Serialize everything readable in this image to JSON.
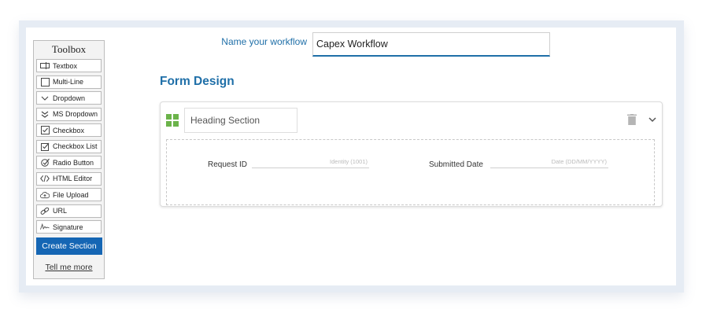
{
  "workflow": {
    "label": "Name your workflow",
    "value": "Capex Workflow"
  },
  "toolbox": {
    "title": "Toolbox",
    "items": [
      {
        "label": "Textbox",
        "icon": "textbox-icon"
      },
      {
        "label": "Multi-Line",
        "icon": "multiline-icon"
      },
      {
        "label": "Dropdown",
        "icon": "dropdown-icon"
      },
      {
        "label": "MS Dropdown",
        "icon": "ms-dropdown-icon"
      },
      {
        "label": "Checkbox",
        "icon": "checkbox-icon"
      },
      {
        "label": "Checkbox List",
        "icon": "checkbox-list-icon"
      },
      {
        "label": "Radio Button",
        "icon": "radio-button-icon"
      },
      {
        "label": "HTML Editor",
        "icon": "code-icon"
      },
      {
        "label": "File Upload",
        "icon": "cloud-upload-icon"
      },
      {
        "label": "URL",
        "icon": "link-icon"
      },
      {
        "label": "Signature",
        "icon": "signature-icon"
      }
    ],
    "create_button": "Create Section",
    "tell_more": "Tell me more"
  },
  "form": {
    "title": "Form Design",
    "section": {
      "heading_value": "Heading Section",
      "fields": [
        {
          "label": "Request ID",
          "placeholder": "Identity (1001)"
        },
        {
          "label": "Submitted Date",
          "placeholder": "Date (DD/MM/YYYY)"
        }
      ]
    }
  },
  "colors": {
    "accent": "#1f6fa8",
    "button": "#1566b4",
    "drag_handle": "#6bb34a",
    "frame": "#e6ecf4"
  }
}
